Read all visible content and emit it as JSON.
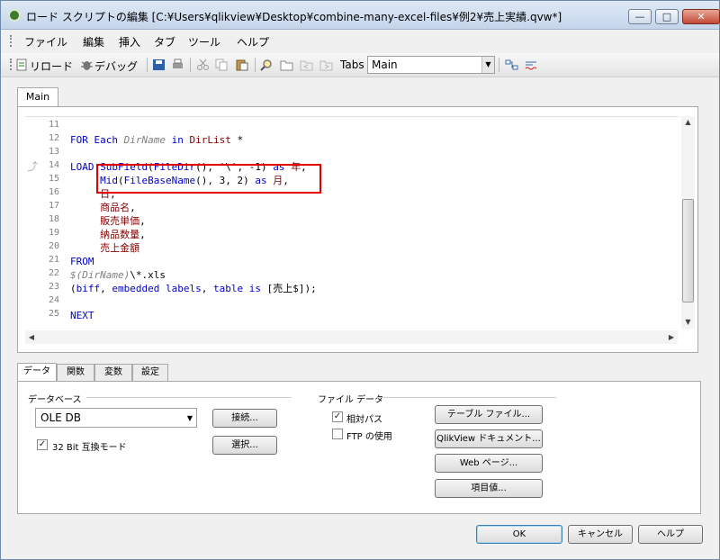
{
  "window": {
    "title": "ロード スクリプトの編集 [C:¥Users¥qlikview¥Desktop¥combine-many-excel-files¥例2¥売上実績.qvw*]",
    "min_glyph": "—",
    "max_glyph": "□",
    "close_glyph": "✕"
  },
  "menu": [
    "ファイル",
    "編集",
    "挿入",
    "タブ",
    "ツール",
    "ヘルプ"
  ],
  "toolbar": {
    "reload_label": "リロード",
    "debug_label": "デバッグ",
    "tabs_label": "Tabs",
    "tabs_value": "Main"
  },
  "editor": {
    "tab_label": "Main",
    "line_numbers": [
      "11",
      "12",
      "13",
      "14",
      "15",
      "16",
      "17",
      "18",
      "19",
      "20",
      "21",
      "22",
      "23",
      "24",
      "25"
    ]
  },
  "bottom": {
    "tabs": [
      "データ",
      "関数",
      "変数",
      "設定"
    ],
    "database_group": "データベース",
    "database_value": "OLE DB",
    "connect_button": "接続...",
    "select_button": "選択...",
    "bit32_label": "32 Bit 互換モード",
    "bit32_checked": true,
    "filedata_group": "ファイル データ",
    "relative_path_label": "相対パス",
    "relative_path_checked": true,
    "ftp_label": "FTP の使用",
    "ftp_checked": false,
    "table_file_button": "テーブル ファイル...",
    "qlikview_doc_button": "QlikView ドキュメント...",
    "web_page_button": "Web ページ...",
    "field_value_button": "項目値..."
  },
  "footer": {
    "ok_button": "OK",
    "cancel_button": "キャンセル",
    "help_button": "ヘルプ"
  }
}
